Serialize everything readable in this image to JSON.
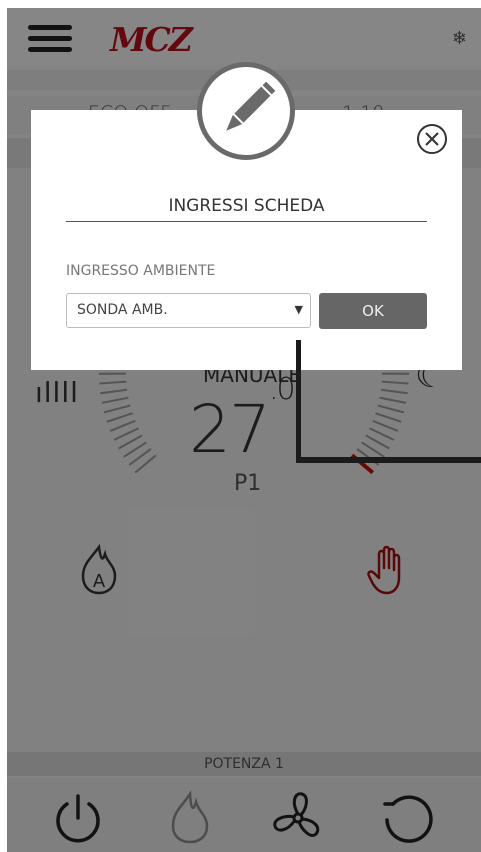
{
  "header": {
    "logo_text": "MCZ",
    "menu_icon": "hamburger-menu-icon",
    "season_icon": "snowflake-icon"
  },
  "status_row": {
    "left_text": "ECO OFF",
    "right_text": "1.10"
  },
  "dashboard": {
    "mode_label": "MANUALE",
    "temperature_integer": "27",
    "temperature_decimal": ".0",
    "power_level": "P1",
    "power_label": "POTENZA 1"
  },
  "modal": {
    "title": "INGRESSI SCHEDA",
    "field_label": "INGRESSO AMBIENTE",
    "selected_option": "SONDA AMB.",
    "ok_label": "OK"
  },
  "colors": {
    "brand": "#b3101a",
    "overlay": "rgba(0,0,0,0.45)",
    "ok_button": "#666666"
  }
}
